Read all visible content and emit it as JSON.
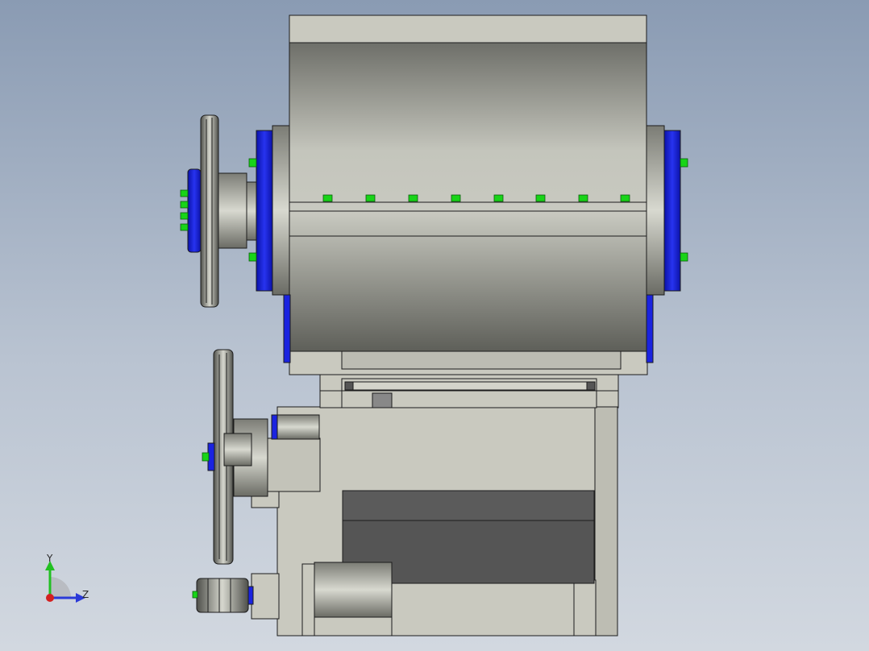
{
  "viewport": {
    "background_top": "#8a9bb3",
    "background_bottom": "#d2d8e0"
  },
  "model": {
    "body_color": "#c9c9bf",
    "drum_color": "#a9aaa2",
    "flange_color": "#1a23e0",
    "bolt_color": "#18d418",
    "dark_panel_color": "#5b5b5b",
    "edge_color": "#1c1c1c"
  },
  "triad": {
    "y_label": "Y",
    "z_label": "Z",
    "y_color": "#22c022",
    "z_color": "#2b3ad8",
    "origin_color": "#d42020"
  }
}
